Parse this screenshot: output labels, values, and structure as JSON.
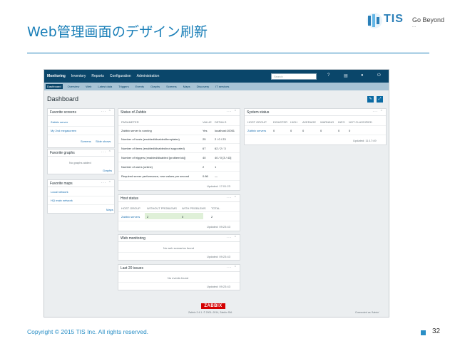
{
  "slide": {
    "title": "Web管理画面のデザイン刷新",
    "copyright": "Copyright © 2015 TIS Inc. All rights reserved.",
    "page_number": "32",
    "accent_color": "#1a7fb8",
    "logo": {
      "name": "TIS",
      "line1": "Go Beyond",
      "line2": "..."
    }
  },
  "zabbix": {
    "top_nav": [
      "Monitoring",
      "Inventory",
      "Reports",
      "Configuration",
      "Administration"
    ],
    "search_placeholder": "Search",
    "top_icons": [
      "help-icon",
      "print-icon",
      "user-icon",
      "logout-icon"
    ],
    "sub_nav": [
      "Dashboard",
      "Overview",
      "Web",
      "Latest data",
      "Triggers",
      "Events",
      "Graphs",
      "Screens",
      "Maps",
      "Discovery",
      "IT services"
    ],
    "page_title": "Dashboard",
    "widgets": {
      "favorite_screens": {
        "title": "Favorite screens",
        "items": [
          "Zabbix server",
          "My 2nd megascreen"
        ],
        "links": [
          "Screens",
          "Slide shows"
        ]
      },
      "favorite_graphs": {
        "title": "Favorite graphs",
        "empty": "No graphs added",
        "link": "Graphs"
      },
      "favorite_maps": {
        "title": "Favorite maps",
        "items": [
          "Local network",
          "HQ main network"
        ],
        "link": "Maps"
      },
      "status_of_zabbix": {
        "title": "Status of Zabbix",
        "headers": [
          "PARAMETER",
          "VALUE",
          "DETAILS"
        ],
        "rows": [
          [
            "Zabbix server is running",
            "Yes",
            "localhost:10051"
          ],
          [
            "Number of hosts (enabled/disabled/templates)",
            "25",
            "2 / 0 / 23"
          ],
          [
            "Number of items (enabled/disabled/not supported)",
            "67",
            "62 / 2 / 3"
          ],
          [
            "Number of triggers (enabled/disabled [problem/ok])",
            "40",
            "40 / 0 [3 / 43]"
          ],
          [
            "Number of users (online)",
            "2",
            "1"
          ],
          [
            "Required server performance, new values per second",
            "0.86",
            "—"
          ]
        ],
        "updated": "Updated: 17:01:23"
      },
      "system_status": {
        "title": "System status",
        "headers": [
          "HOST GROUP",
          "DISASTER",
          "HIGH",
          "AVERAGE",
          "WARNING",
          "INFO",
          "NOT CLASSIFIED"
        ],
        "rows": [
          [
            "Zabbix servers",
            "0",
            "0",
            "0",
            "0",
            "0",
            "0"
          ]
        ],
        "updated": "Updated: 11:17:49"
      },
      "host_status": {
        "title": "Host status",
        "headers": [
          "HOST GROUP",
          "WITHOUT PROBLEMS",
          "WITH PROBLEMS",
          "TOTAL"
        ],
        "rows": [
          [
            "Zabbix servers",
            "2",
            "0",
            "2"
          ]
        ],
        "updated": "Updated: 09:23:43"
      },
      "web_monitoring": {
        "title": "Web monitoring",
        "empty": "No web scenarios found",
        "updated": "Updated: 09:23:43"
      },
      "last_issues": {
        "title": "Last 20 issues",
        "empty": "No events found",
        "updated": "Updated: 09:23:43"
      }
    },
    "footer": {
      "logo": "ZABBIX",
      "version": "Zabbix 2.4.1. © 2001–2014, Zabbix SIA",
      "connected": "Connected as 'Admin'"
    }
  }
}
